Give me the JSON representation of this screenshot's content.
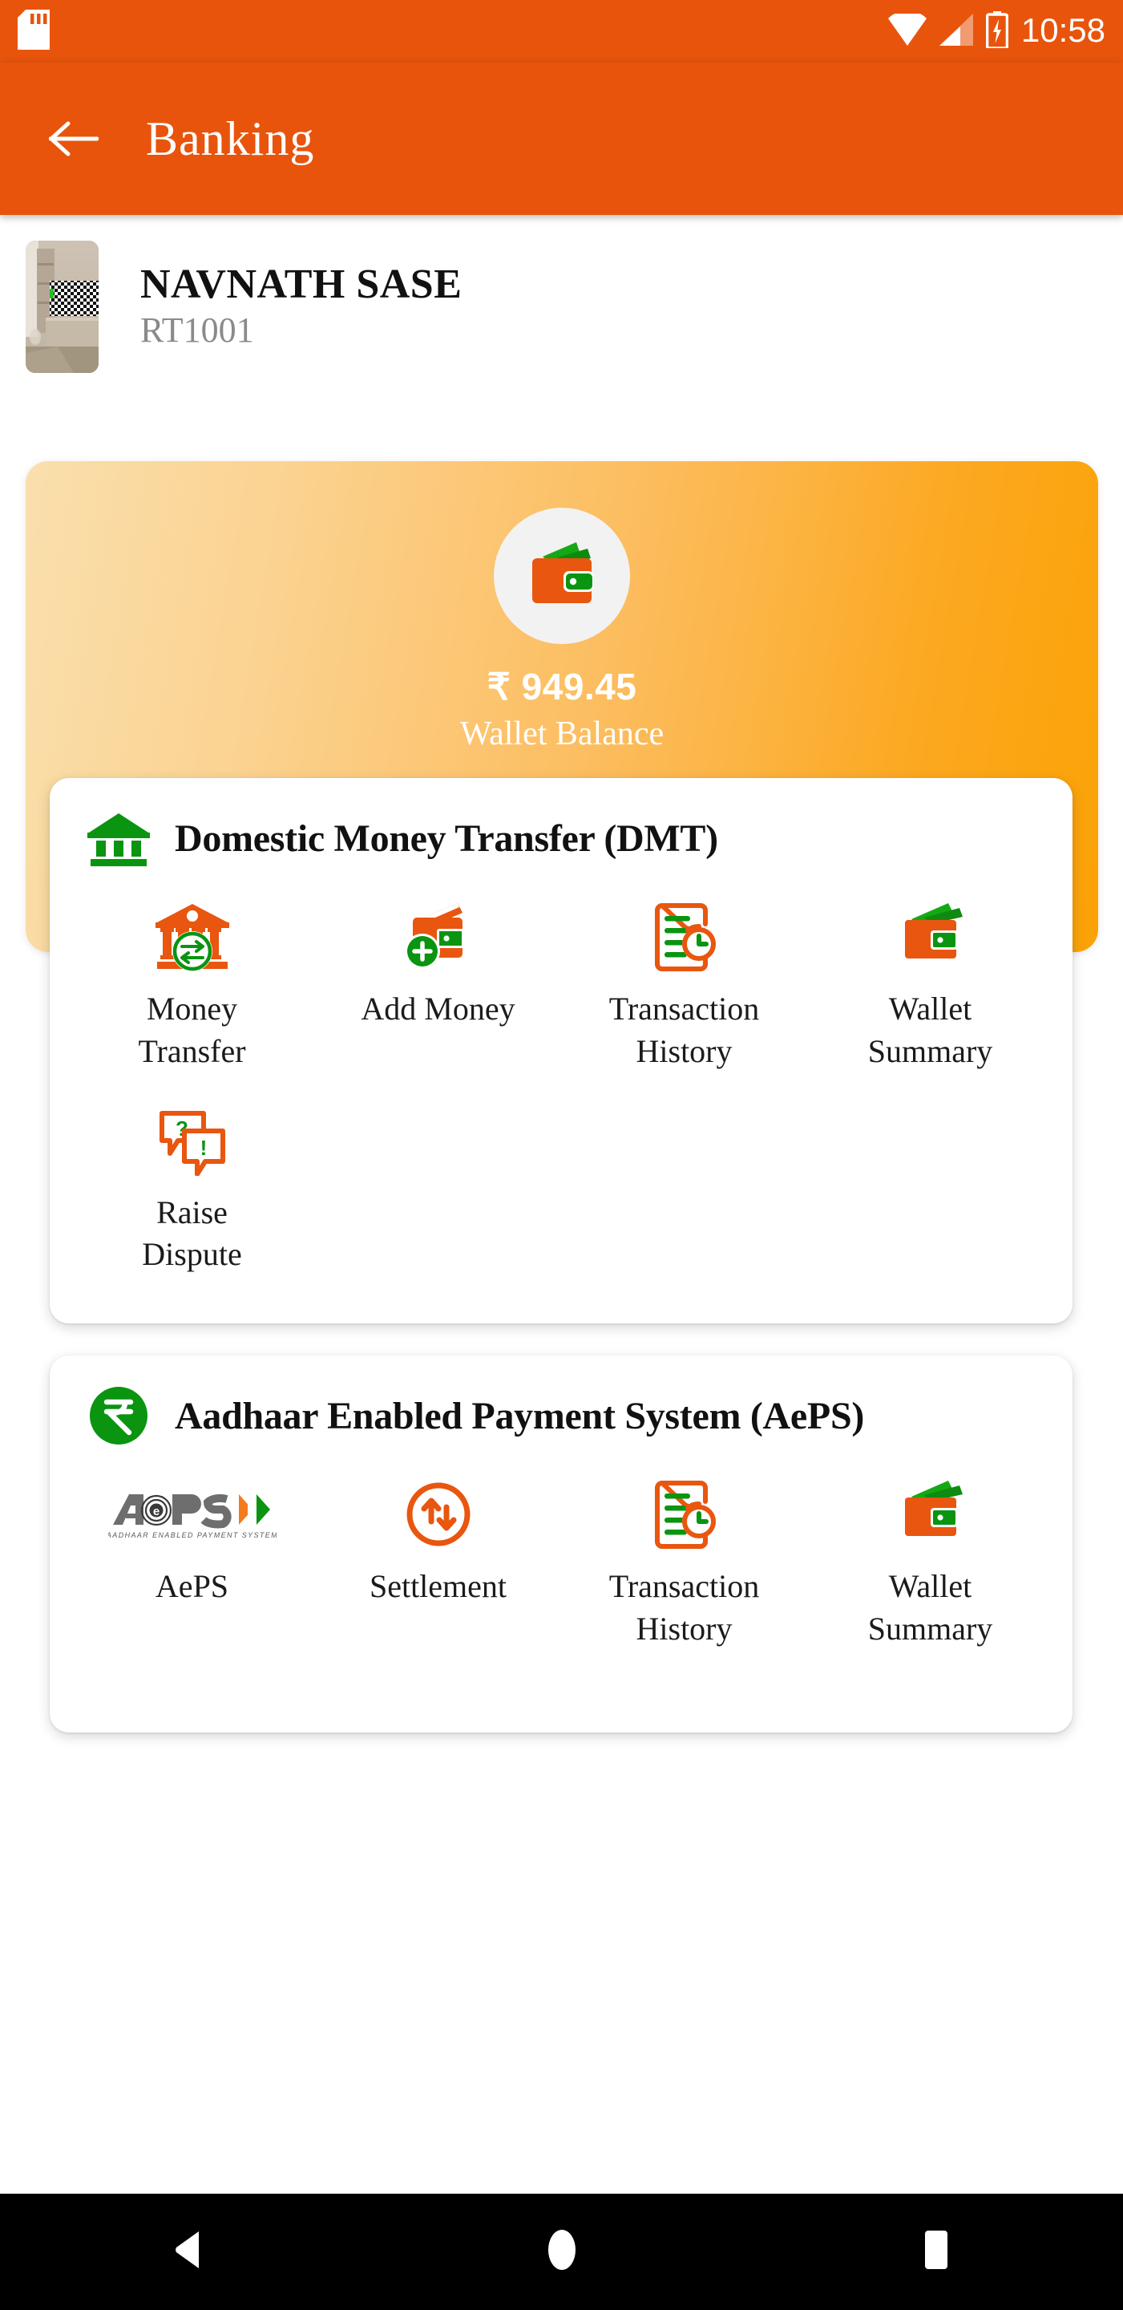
{
  "statusbar": {
    "time": "10:58",
    "icons": [
      "sd-card-icon",
      "wifi-icon",
      "cellular-signal-icon",
      "battery-charging-icon"
    ]
  },
  "appbar": {
    "title": "Banking",
    "back_label": "Back"
  },
  "profile": {
    "name": "NAVNATH SASE",
    "id": "RT1001"
  },
  "wallet": {
    "amount": "₹ 949.45",
    "label": "Wallet Balance"
  },
  "sections": [
    {
      "id": "dmt",
      "title": "Domestic Money Transfer (DMT)",
      "icon": "bank-icon",
      "items": [
        {
          "label": "Money Transfer",
          "icon": "money-transfer-icon",
          "wrap": true
        },
        {
          "label": "Add Money",
          "icon": "add-money-wallet-icon",
          "wrap": false
        },
        {
          "label": "Transaction History",
          "icon": "transaction-history-icon",
          "wrap": true
        },
        {
          "label": "Wallet Summary",
          "icon": "wallet-summary-icon",
          "wrap": true
        },
        {
          "label": "Raise Dispute",
          "icon": "raise-dispute-icon",
          "wrap": true
        }
      ]
    },
    {
      "id": "aeps",
      "title": "Aadhaar Enabled Payment System (AePS)",
      "icon": "rupee-circle-icon",
      "items": [
        {
          "label": "AePS",
          "icon": "aeps-logo-icon",
          "wrap": false
        },
        {
          "label": "Settlement",
          "icon": "settlement-icon",
          "wrap": false
        },
        {
          "label": "Transaction History",
          "icon": "transaction-history-icon",
          "wrap": true
        },
        {
          "label": "Wallet Summary",
          "icon": "wallet-summary-icon",
          "wrap": true
        }
      ]
    }
  ],
  "aeps_logo": {
    "mark": "AePS",
    "tagline": "AADHAAR ENABLED PAYMENT SYSTEM"
  },
  "navbar": {
    "back": "back-triangle-icon",
    "home": "home-circle-icon",
    "recents": "recents-square-icon"
  },
  "colors": {
    "brand_orange": "#e8540c",
    "icon_orange": "#e8560f",
    "icon_green": "#0a9410",
    "gradient_start": "#fadfad",
    "gradient_end": "#fba206",
    "text_dark": "#111111",
    "text_muted": "#8a8a8a"
  }
}
